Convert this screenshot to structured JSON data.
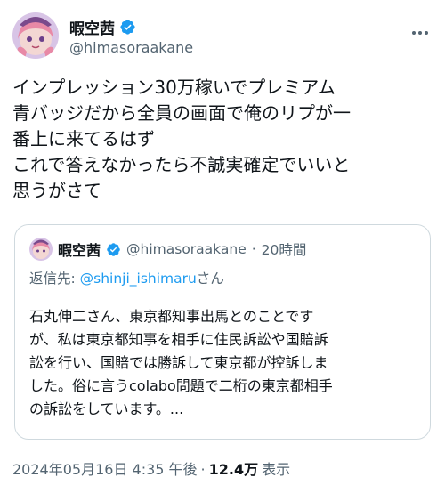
{
  "author": {
    "display_name": "暇空茜",
    "handle": "@himasoraakane",
    "avatar_icon": "anime-avatar-icon",
    "verified_icon": "verified-badge-icon"
  },
  "tweet": {
    "lines": [
      "インプレッション30万稼いでプレミアム",
      "青バッジだから全員の画面で俺のリプが一",
      "番上に来てるはず",
      "これで答えなかったら不誠実確定でいいと",
      "思うがさて"
    ]
  },
  "quoted_tweet": {
    "display_name": "暇空茜",
    "handle": "@himasoraakane",
    "separator": "·",
    "time": "20時間",
    "reply_prefix": "返信先: ",
    "reply_mention": "@shinji_ishimaru",
    "reply_suffix": "さん",
    "lines": [
      "石丸伸二さん、東京都知事出馬とのことです",
      "が、私は東京都知事を相手に住民訴訟や国賠訴",
      "訟を行い、国賠では勝訴して東京都が控訴しま",
      "した。俗に言うcolabo問題で二桁の東京都相手",
      "の訴訟をしています。..."
    ]
  },
  "meta": {
    "timestamp": "2024年05月16日 4:35 午後",
    "separator": "·",
    "views_count": "12.4万",
    "views_label": "表示"
  },
  "colors": {
    "accent": "#1d9bf0",
    "text": "#0f1419",
    "secondary": "#536471",
    "border": "#cfd9de"
  },
  "more_icon": "more-horizontal-icon"
}
